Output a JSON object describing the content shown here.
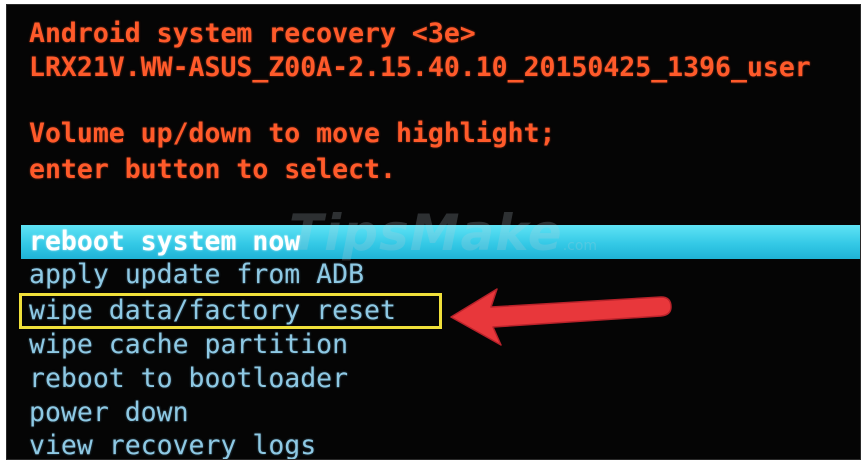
{
  "recovery": {
    "title": "Android system recovery <3e>",
    "build": "LRX21V.WW-ASUS_Z00A-2.15.40.10_20150425_1396_user",
    "instructions": [
      "Volume up/down to move highlight;",
      "enter button to select."
    ]
  },
  "menu": {
    "items": [
      {
        "label": "reboot system now",
        "selected": true
      },
      {
        "label": "apply update from ADB",
        "selected": false
      },
      {
        "label": "wipe data/factory reset",
        "selected": false
      },
      {
        "label": "wipe cache partition",
        "selected": false
      },
      {
        "label": "reboot to bootloader",
        "selected": false
      },
      {
        "label": "power down",
        "selected": false
      },
      {
        "label": "view recovery logs",
        "selected": false
      }
    ]
  },
  "annotation": {
    "highlighted_item": "wipe data/factory reset",
    "box_color": "#f0e03a",
    "arrow_color": "#e8373b",
    "arrow_icon": "arrow-left-icon"
  },
  "watermark": {
    "text": "TipsMake",
    "suffix": ".com"
  },
  "colors": {
    "background": "#050505",
    "header_text": "#ff5a2a",
    "menu_text": "#8ec9e4",
    "highlight_bar": "#34c9e6",
    "selected_text": "#ffffff"
  }
}
